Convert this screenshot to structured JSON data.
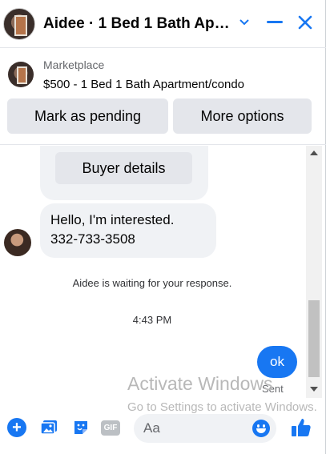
{
  "header": {
    "title": "Aidee · 1 Bed 1 Bath Apart...",
    "icons": [
      "chevron-down-icon",
      "minimize-icon",
      "close-icon"
    ],
    "accent_color": "#1877f2"
  },
  "listing": {
    "category": "Marketplace",
    "title": "$500 - 1 Bed 1 Bath Apartment/condo",
    "mark_pending_label": "Mark as pending",
    "more_options_label": "More options"
  },
  "conversation": {
    "buyer_details_label": "Buyer details",
    "incoming_message": {
      "line1": "Hello, I'm interested.",
      "line2": "332-733-3508"
    },
    "waiting_notice": "Aidee is waiting for your response.",
    "timestamp": "4:43 PM",
    "outgoing_message": "ok",
    "outgoing_status": "Sent"
  },
  "watermark": {
    "line1": "Activate Windows",
    "line2": "Go to Settings to activate Windows."
  },
  "composer": {
    "placeholder": "Aa",
    "gif_label": "GIF",
    "icons": [
      "plus-icon",
      "photo-icon",
      "sticker-icon",
      "gif-icon",
      "emoji-icon",
      "thumbs-up-icon"
    ]
  }
}
